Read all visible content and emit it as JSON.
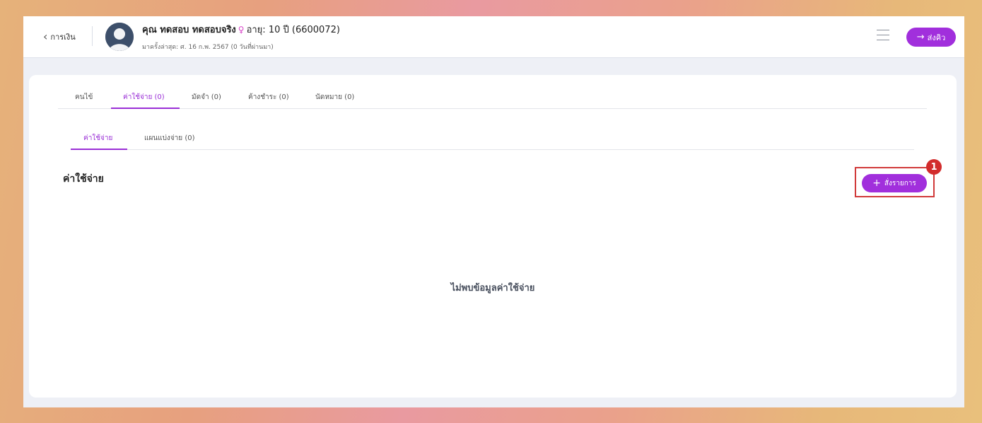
{
  "header": {
    "back_label": "การเงิน",
    "patient_name": "คุณ ทดสอบ ทดสอบจริง",
    "gender_symbol": "♀",
    "age_info": "อายุ: 10 ปี (6600072)",
    "last_visit": "มาครั้งล่าสุด: ศ. 16 ก.พ. 2567 (0 วันที่ผ่านมา)",
    "queue_button": "ส่งคิว",
    "queue_icon": "→"
  },
  "tabs": [
    {
      "label": "คนไข้",
      "active": false
    },
    {
      "label": "ค่าใช้จ่าย (0)",
      "active": true
    },
    {
      "label": "มัดจำ (0)",
      "active": false
    },
    {
      "label": "ค้างชำระ (0)",
      "active": false
    },
    {
      "label": "นัดหมาย (0)",
      "active": false
    }
  ],
  "subtabs": [
    {
      "label": "ค่าใช้จ่าย",
      "active": true
    },
    {
      "label": "แผนแบ่งจ่าย (0)",
      "active": false
    }
  ],
  "section": {
    "title": "ค่าใช้จ่าย",
    "order_button": "สั่งรายการ",
    "order_icon": "+",
    "empty_message": "ไม่พบข้อมูลค่าใช้จ่าย"
  },
  "annotation": {
    "badge": "1"
  },
  "colors": {
    "accent": "#a12fdc",
    "annotation": "#d13a3a"
  }
}
